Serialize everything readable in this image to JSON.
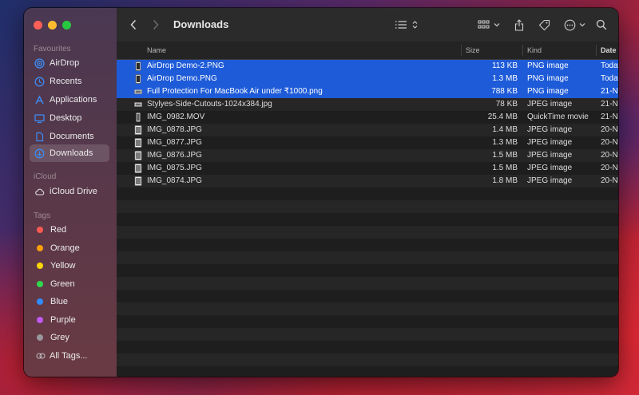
{
  "window": {
    "title": "Downloads"
  },
  "sidebar": {
    "favourites_label": "Favourites",
    "favourites": [
      {
        "label": "AirDrop",
        "icon": "airdrop-icon"
      },
      {
        "label": "Recents",
        "icon": "clock-icon"
      },
      {
        "label": "Applications",
        "icon": "applications-icon"
      },
      {
        "label": "Desktop",
        "icon": "desktop-icon"
      },
      {
        "label": "Documents",
        "icon": "document-icon"
      },
      {
        "label": "Downloads",
        "icon": "download-icon"
      }
    ],
    "icloud_label": "iCloud",
    "icloud": [
      {
        "label": "iCloud Drive",
        "icon": "cloud-icon"
      }
    ],
    "tags_label": "Tags",
    "tags": [
      {
        "label": "Red",
        "color": "#ff5a52"
      },
      {
        "label": "Orange",
        "color": "#ff9f0a"
      },
      {
        "label": "Yellow",
        "color": "#ffd60a"
      },
      {
        "label": "Green",
        "color": "#32d74b"
      },
      {
        "label": "Blue",
        "color": "#2f8cff"
      },
      {
        "label": "Purple",
        "color": "#bf5af2"
      },
      {
        "label": "Grey",
        "color": "#98989d"
      },
      {
        "label": "All Tags...",
        "color": ""
      }
    ]
  },
  "columns": {
    "name": "Name",
    "size": "Size",
    "kind": "Kind",
    "date": "Date"
  },
  "files": [
    {
      "name": "AirDrop Demo-2.PNG",
      "size": "113 KB",
      "kind": "PNG image",
      "date": "Today",
      "selected": true,
      "icon": "phone-screenshot-icon"
    },
    {
      "name": "AirDrop Demo.PNG",
      "size": "1.3 MB",
      "kind": "PNG image",
      "date": "Today",
      "selected": true,
      "icon": "phone-screenshot-icon"
    },
    {
      "name": "Full Protection For MacBook Air under ₹1000.png",
      "size": "788 KB",
      "kind": "PNG image",
      "date": "21-N",
      "selected": true,
      "icon": "wide-image-icon"
    },
    {
      "name": "Stylyes-Side-Cutouts-1024x384.jpg",
      "size": "78 KB",
      "kind": "JPEG image",
      "date": "21-N",
      "selected": false,
      "icon": "wide-image-icon"
    },
    {
      "name": "IMG_0982.MOV",
      "size": "25.4 MB",
      "kind": "QuickTime movie",
      "date": "21-N",
      "selected": false,
      "icon": "movie-icon"
    },
    {
      "name": "IMG_0878.JPG",
      "size": "1.4 MB",
      "kind": "JPEG image",
      "date": "20-N",
      "selected": false,
      "icon": "photo-icon"
    },
    {
      "name": "IMG_0877.JPG",
      "size": "1.3 MB",
      "kind": "JPEG image",
      "date": "20-N",
      "selected": false,
      "icon": "photo-icon"
    },
    {
      "name": "IMG_0876.JPG",
      "size": "1.5 MB",
      "kind": "JPEG image",
      "date": "20-N",
      "selected": false,
      "icon": "photo-icon"
    },
    {
      "name": "IMG_0875.JPG",
      "size": "1.5 MB",
      "kind": "JPEG image",
      "date": "20-N",
      "selected": false,
      "icon": "photo-icon"
    },
    {
      "name": "IMG_0874.JPG",
      "size": "1.8 MB",
      "kind": "JPEG image",
      "date": "20-N",
      "selected": false,
      "icon": "photo-icon"
    }
  ],
  "colors": {
    "selection": "#1e5bd8",
    "accent": "#0a84ff"
  }
}
